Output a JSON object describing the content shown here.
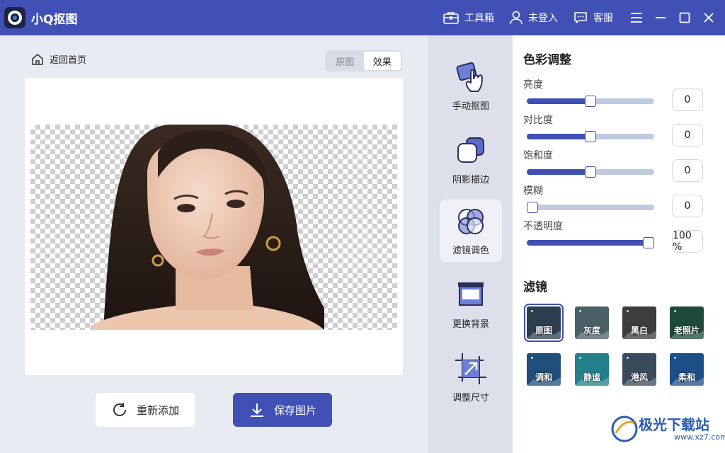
{
  "app": {
    "title": "小Q抠图"
  },
  "titlebar": {
    "toolbox": "工具箱",
    "login": "未登入",
    "support": "客服"
  },
  "canvas": {
    "back_home": "返回首页",
    "view_original": "原图",
    "view_effect": "效果",
    "active_view": "效果"
  },
  "actions": {
    "readd": "重新添加",
    "save": "保存图片"
  },
  "tools": [
    {
      "label": "手动抠图",
      "icon": "hand-touch-icon"
    },
    {
      "label": "阴影描边",
      "icon": "shadow-stroke-icon"
    },
    {
      "label": "滤镜调色",
      "icon": "filter-palette-icon",
      "active": true
    },
    {
      "label": "更换背景",
      "icon": "background-icon"
    },
    {
      "label": "调整尺寸",
      "icon": "resize-icon"
    }
  ],
  "color_adjust": {
    "title": "色彩调整",
    "items": [
      {
        "label": "亮度",
        "value": "0",
        "level": 0.5
      },
      {
        "label": "对比度",
        "value": "0",
        "level": 0.5
      },
      {
        "label": "饱和度",
        "value": "0",
        "level": 0.5
      },
      {
        "label": "模糊",
        "value": "0",
        "level": 0.0
      },
      {
        "label": "不透明度",
        "value": "100 %",
        "level": 1.0
      }
    ]
  },
  "filters": {
    "title": "滤镜",
    "items": [
      {
        "label": "原图",
        "color": "#2c3e50",
        "selected": true
      },
      {
        "label": "灰度",
        "color": "#4a5f66"
      },
      {
        "label": "黑白",
        "color": "#3c3c3c"
      },
      {
        "label": "老照片",
        "color": "#1e4a3a"
      },
      {
        "label": "调和",
        "color": "#1f4e7a"
      },
      {
        "label": "静谧",
        "color": "#237f8a"
      },
      {
        "label": "港风",
        "color": "#3b4a5a"
      },
      {
        "label": "柔和",
        "color": "#1c4f86"
      }
    ]
  },
  "watermark": {
    "name": "极光下载站",
    "url": "www.xz7.com"
  },
  "colors": {
    "accent": "#4050b5",
    "titlebar": "#4050b5"
  }
}
